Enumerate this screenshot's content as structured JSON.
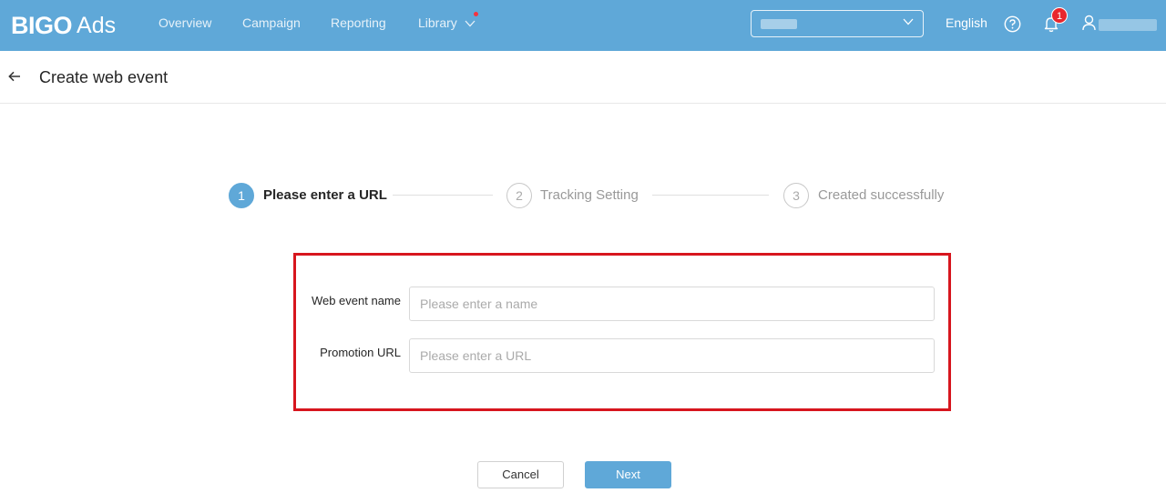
{
  "brand": {
    "logo_main": "BIGO",
    "logo_sub": "Ads",
    "accent": "#5fa8d8"
  },
  "nav": {
    "items": [
      {
        "label": "Overview"
      },
      {
        "label": "Campaign"
      },
      {
        "label": "Reporting"
      },
      {
        "label": "Library"
      }
    ]
  },
  "header_right": {
    "language": "English",
    "notification_count": "1"
  },
  "page": {
    "title": "Create web event"
  },
  "steps": [
    {
      "number": "1",
      "label": "Please enter a URL",
      "state": "active"
    },
    {
      "number": "2",
      "label": "Tracking Setting",
      "state": "idle"
    },
    {
      "number": "3",
      "label": "Created successfully",
      "state": "idle"
    }
  ],
  "form": {
    "event_name": {
      "label": "Web event name",
      "placeholder": "Please enter a name",
      "value": ""
    },
    "promotion_url": {
      "label": "Promotion URL",
      "placeholder": "Please enter a URL",
      "value": ""
    },
    "highlight_color": "#d7161e"
  },
  "actions": {
    "cancel": "Cancel",
    "next": "Next"
  }
}
